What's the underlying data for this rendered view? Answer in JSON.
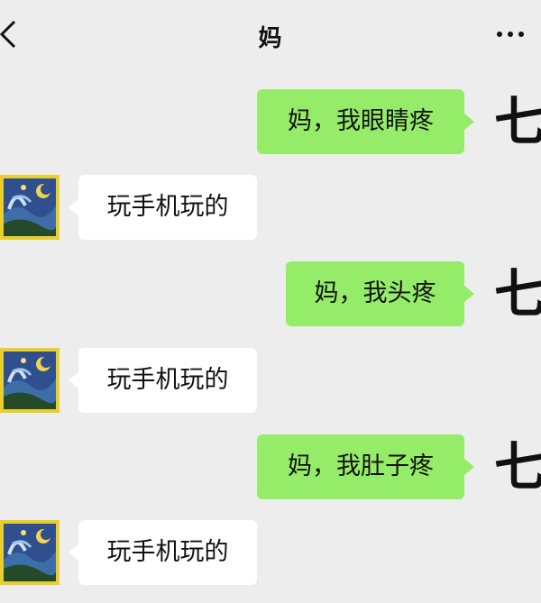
{
  "header": {
    "back_icon": "chevron-left-icon",
    "title": "妈",
    "more_icon": "ellipsis-icon"
  },
  "colors": {
    "background": "#ededed",
    "my_bubble": "#95ec69",
    "their_bubble": "#ffffff",
    "avatar_frame": "#e8cf2d"
  },
  "messages": [
    {
      "sender": "me",
      "text": "妈，我眼睛疼",
      "avatar_text": "七"
    },
    {
      "sender": "mom",
      "text": "玩手机玩的",
      "avatar_icon": "starry-night-painting-avatar"
    },
    {
      "sender": "me",
      "text": "妈，我头疼",
      "avatar_text": "七"
    },
    {
      "sender": "mom",
      "text": "玩手机玩的",
      "avatar_icon": "starry-night-painting-avatar"
    },
    {
      "sender": "me",
      "text": "妈，我肚子疼",
      "avatar_text": "七"
    },
    {
      "sender": "mom",
      "text": "玩手机玩的",
      "avatar_icon": "starry-night-painting-avatar"
    }
  ]
}
